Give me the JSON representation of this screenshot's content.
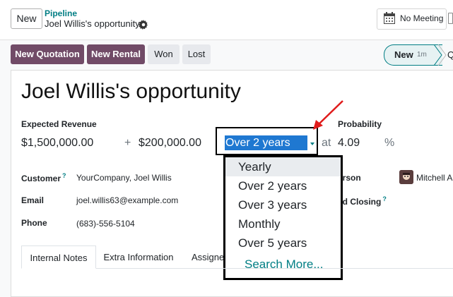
{
  "header": {
    "new_label": "New",
    "breadcrumb_parent": "Pipeline",
    "breadcrumb_current": "Joel Willis's opportunity",
    "meeting_label": "No Meeting"
  },
  "actions": {
    "new_quotation": "New Quotation",
    "new_rental": "New Rental",
    "won": "Won",
    "lost": "Lost"
  },
  "stage": {
    "current": "New",
    "time": "1m",
    "next_initial": "Q"
  },
  "form": {
    "title": "Joel Willis's opportunity",
    "expected_revenue_label": "Expected Revenue",
    "expected_revenue": "$1,500,000.00",
    "plus": "+",
    "recurring_revenue": "$200,000.00",
    "recurring_plan": "Over 2 years",
    "at": "at",
    "probability_label": "Probability",
    "probability": "4.09",
    "percent": "%",
    "customer_label": "Customer",
    "customer_help": "?",
    "customer": "YourCompany, Joel Willis",
    "email_label": "Email",
    "email": "joel.willis63@example.com",
    "phone_label": "Phone",
    "phone": "(683)-556-5104",
    "salesperson_label_partial": "erson",
    "salesperson": "Mitchell A",
    "expected_closing_label_partial": "ed Closing",
    "expected_closing_help": "?"
  },
  "dropdown": {
    "options": [
      "Yearly",
      "Over 2 years",
      "Over 3 years",
      "Monthly",
      "Over 5 years"
    ],
    "search_more": "Search More..."
  },
  "tabs": [
    "Internal Notes",
    "Extra Information",
    "Assigned"
  ],
  "colors": {
    "primary": "#714b67",
    "accent": "#017e84",
    "selection": "#1f78d1",
    "annotation_arrow": "#e01b1b"
  }
}
